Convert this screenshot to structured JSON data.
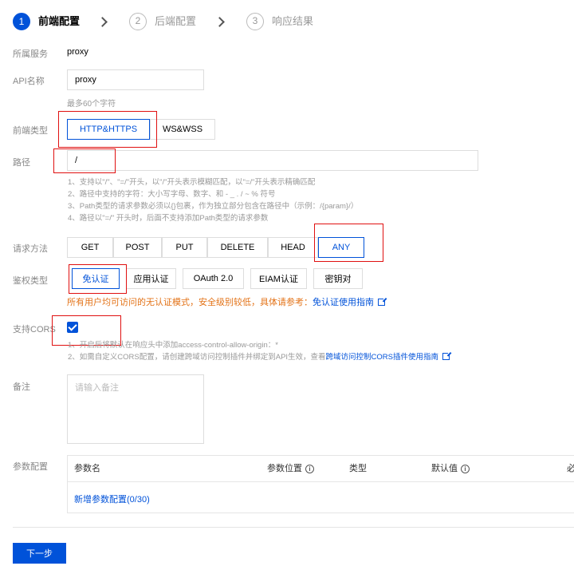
{
  "steps": [
    {
      "num": "1",
      "label": "前端配置"
    },
    {
      "num": "2",
      "label": "后端配置"
    },
    {
      "num": "3",
      "label": "响应结果"
    }
  ],
  "labels": {
    "service": "所属服务",
    "api_name": "API名称",
    "frontend_type": "前端类型",
    "path": "路径",
    "method": "请求方法",
    "auth": "鉴权类型",
    "cors": "支持CORS",
    "remark": "备注",
    "params": "参数配置"
  },
  "service_value": "proxy",
  "api_name_value": "proxy",
  "api_name_hint": "最多60个字符",
  "frontend_types": [
    "HTTP&HTTPS",
    "WS&WSS"
  ],
  "path_value": "/",
  "path_notes": [
    "1、支持以\"/\"、\"=/\"开头，以\"/\"开头表示模糊匹配，以\"=/\"开头表示精确匹配",
    "2、路径中支持的字符：大小写字母、数字、和 - _ . / ~ % 符号",
    "3、Path类型的请求参数必须以{}包裹，作为独立部分包含在路径中（示例：/{param}/）",
    "4、路径以\"=/\" 开头时，后面不支持添加Path类型的请求参数"
  ],
  "methods": [
    "GET",
    "POST",
    "PUT",
    "DELETE",
    "HEAD",
    "ANY"
  ],
  "auth_types": [
    "免认证",
    "应用认证",
    "OAuth 2.0",
    "EIAM认证",
    "密钥对"
  ],
  "auth_warning": "所有用户均可访问的无认证模式，安全级别较低，具体请参考：",
  "auth_warning_link": "免认证使用指南",
  "cors_notes": {
    "line1": "1、开启后将默认在响应头中添加access-control-allow-origin：*",
    "line2": "2、如需自定义CORS配置，请创建跨域访问控制插件并绑定到API生效，查看",
    "line2_link": "跨域访问控制CORS插件使用指南"
  },
  "remark_placeholder": "请输入备注",
  "param_table": {
    "headers": [
      "参数名",
      "参数位置",
      "类型",
      "默认值",
      "必"
    ],
    "add_label": "新增参数配置(0/30)"
  },
  "next_button": "下一步",
  "colors": {
    "accent": "#0052d9",
    "warning": "#e37318",
    "annotation": "#e01010"
  }
}
